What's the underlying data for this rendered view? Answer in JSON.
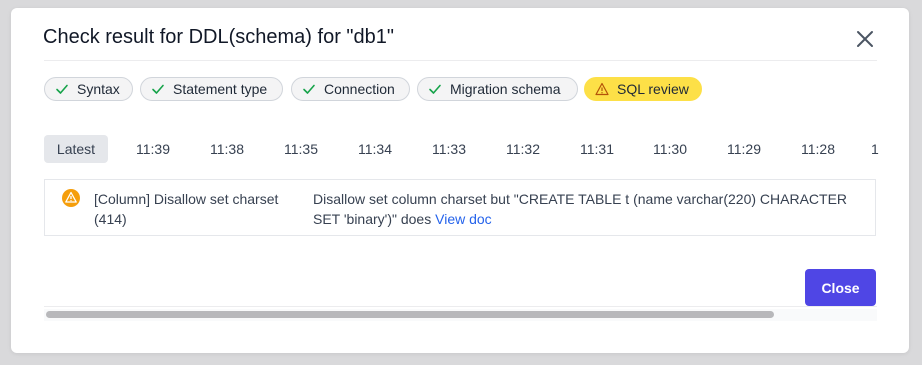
{
  "dialog": {
    "title": "Check result for DDL(schema) for \"db1\"",
    "close_icon": "close-icon"
  },
  "checks": [
    {
      "label": "Syntax",
      "status": "success",
      "icon": "check-icon"
    },
    {
      "label": "Statement type",
      "status": "success",
      "icon": "check-icon"
    },
    {
      "label": "Connection",
      "status": "success",
      "icon": "check-icon"
    },
    {
      "label": "Migration schema",
      "status": "success",
      "icon": "check-icon"
    },
    {
      "label": "SQL review",
      "status": "warning",
      "icon": "warning-icon"
    }
  ],
  "timeline": {
    "active": "Latest",
    "items": [
      "Latest",
      "11:39",
      "11:38",
      "11:35",
      "11:34",
      "11:33",
      "11:32",
      "11:31",
      "11:30",
      "11:29",
      "11:28",
      "1"
    ]
  },
  "result": {
    "icon": "warning-circle-icon",
    "rule": "[Column] Disallow set charset (414)",
    "message": "Disallow set column charset but \"CREATE TABLE t (name varchar(220) CHARACTER SET 'binary')\" does",
    "link": "View doc"
  },
  "footer": {
    "close_label": "Close"
  },
  "colors": {
    "accent": "#4f46e5",
    "success": "#16a34a",
    "warning_chip": "#fde047",
    "warning_icon": "#f59e0b",
    "link": "#2563eb"
  }
}
